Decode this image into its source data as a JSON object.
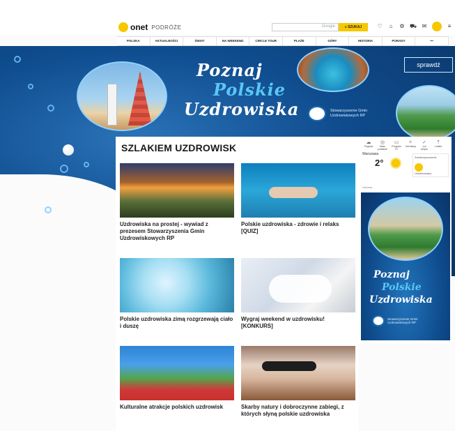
{
  "header": {
    "logo_text": "onet",
    "logo_section": "PODRÓŻE",
    "search_brand": "Google",
    "search_button": "SZUKAJ",
    "icons": [
      "heart-icon",
      "cart-icon",
      "settings-icon",
      "car-icon",
      "mail-icon",
      "user-icon"
    ]
  },
  "nav": {
    "items": [
      "POLSKA",
      "AKTUALNOŚCI",
      "ŚWIAT",
      "NA WEEKEND",
      "CIRCLE TOUR",
      "PLAŻE",
      "GÓRY",
      "HISTORIA",
      "PORADY",
      "•••"
    ]
  },
  "banner": {
    "line1": "Poznaj",
    "line2": "Polskie",
    "line3": "Uzdrowiska",
    "cta": "sprawdź",
    "association": "Stowarzyszenie Gmin Uzdrowiskowych RP"
  },
  "main": {
    "section_title": "SZLAKIEM UZDROWISK",
    "articles": [
      {
        "title": "Uzdrowiska na prostej - wywiad z prezesem Stowarzyszenia Gmin Uzdrowiskowych RP"
      },
      {
        "title": "Polskie uzdrowiska - zdrowie i relaks [QUIZ]"
      },
      {
        "title": "Polskie uzdrowiska zimą rozgrzewają ciało i duszę"
      },
      {
        "title": "Wygraj weekend w uzdrowisku! [KONKURS]"
      },
      {
        "title": "Kulturalne atrakcje polskich uzdrowisk"
      },
      {
        "title": "Skarby natury i dobroczynne zabiegi, z których słyną polskie uzdrowiska"
      }
    ]
  },
  "sidebar": {
    "weather_icons": [
      "Pogoda",
      "Nasz podatnik",
      "Program TV",
      "Horoskop",
      "Lot Artyku",
      "Ludzie"
    ],
    "city": "Warszawa",
    "temperature": "2°",
    "box_label": "Zanieczyszczenie",
    "box_value": "Umiarkowany",
    "ad_label": "reklama",
    "ad_line1": "Poznaj",
    "ad_line2": "Polskie",
    "ad_line3": "Uzdrowiska",
    "ad_association": "Stowarzyszenie Gmin Uzdrowiskowych RP"
  },
  "colors": {
    "accent": "#f6c800",
    "ocean": "#0f4d8f",
    "highlight": "#59c8f4"
  }
}
